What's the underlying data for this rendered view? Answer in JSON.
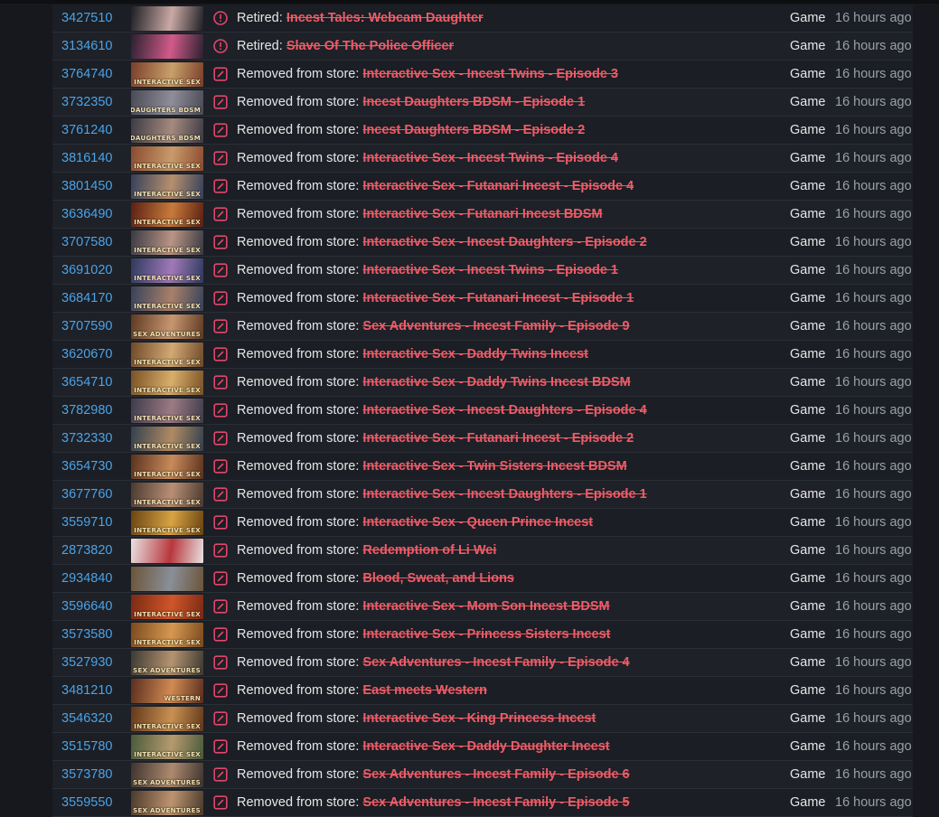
{
  "colors": {
    "link": "#4aa3e8",
    "removed": "#ef5b67",
    "icon": "#e0476a"
  },
  "rows": [
    {
      "appid": "3427510",
      "prefix": "Retired:",
      "name": "Incest Tales: Webcam Daughter",
      "type": "Game",
      "time": "16 hours ago",
      "icon": "alert-circle-icon",
      "thumb_text": "",
      "c1": "#1e1e24",
      "c2": "#c9a9a4"
    },
    {
      "appid": "3134610",
      "prefix": "Retired:",
      "name": "Slave Of The Police Officer",
      "type": "Game",
      "time": "16 hours ago",
      "icon": "alert-circle-icon",
      "thumb_text": "",
      "c1": "#2b2130",
      "c2": "#d15a8a"
    },
    {
      "appid": "3764740",
      "prefix": "Removed from store:",
      "name": "Interactive Sex - Incest Twins - Episode 3",
      "type": "Game",
      "time": "16 hours ago",
      "icon": "edit-square-icon",
      "thumb_text": "INTERACTIVE SEX",
      "c1": "#7a3e2a",
      "c2": "#c8a06a"
    },
    {
      "appid": "3732350",
      "prefix": "Removed from store:",
      "name": "Incest Daughters BDSM - Episode 1",
      "type": "Game",
      "time": "16 hours ago",
      "icon": "edit-square-icon",
      "thumb_text": "INCEST DAUGHTERS BDSM",
      "c1": "#4a4a55",
      "c2": "#8e8d99"
    },
    {
      "appid": "3761240",
      "prefix": "Removed from store:",
      "name": "Incest Daughters BDSM - Episode 2",
      "type": "Game",
      "time": "16 hours ago",
      "icon": "edit-square-icon",
      "thumb_text": "INCEST DAUGHTERS BDSM",
      "c1": "#3d3b44",
      "c2": "#a48a7e"
    },
    {
      "appid": "3816140",
      "prefix": "Removed from store:",
      "name": "Interactive Sex - Incest Twins - Episode 4",
      "type": "Game",
      "time": "16 hours ago",
      "icon": "edit-square-icon",
      "thumb_text": "INTERACTIVE SEX",
      "c1": "#8a4b2f",
      "c2": "#c99a6b"
    },
    {
      "appid": "3801450",
      "prefix": "Removed from store:",
      "name": "Interactive Sex - Futanari Incest - Episode 4",
      "type": "Game",
      "time": "16 hours ago",
      "icon": "edit-square-icon",
      "thumb_text": "INTERACTIVE SEX",
      "c1": "#35405a",
      "c2": "#b68f6e"
    },
    {
      "appid": "3636490",
      "prefix": "Removed from store:",
      "name": "Interactive Sex - Futanari Incest BDSM",
      "type": "Game",
      "time": "16 hours ago",
      "icon": "edit-square-icon",
      "thumb_text": "INTERACTIVE SEX",
      "c1": "#5a2012",
      "c2": "#c87a3a"
    },
    {
      "appid": "3707580",
      "prefix": "Removed from store:",
      "name": "Interactive Sex - Incest Daughters - Episode 2",
      "type": "Game",
      "time": "16 hours ago",
      "icon": "edit-square-icon",
      "thumb_text": "INTERACTIVE SEX",
      "c1": "#3a3a44",
      "c2": "#b99484"
    },
    {
      "appid": "3691020",
      "prefix": "Removed from store:",
      "name": "Interactive Sex - Incest Twins - Episode 1",
      "type": "Game",
      "time": "16 hours ago",
      "icon": "edit-square-icon",
      "thumb_text": "INTERACTIVE SEX",
      "c1": "#2e3a5e",
      "c2": "#a079b8"
    },
    {
      "appid": "3684170",
      "prefix": "Removed from store:",
      "name": "Interactive Sex - Futanari Incest - Episode 1",
      "type": "Game",
      "time": "16 hours ago",
      "icon": "edit-square-icon",
      "thumb_text": "INTERACTIVE SEX",
      "c1": "#37425a",
      "c2": "#a88069"
    },
    {
      "appid": "3707590",
      "prefix": "Removed from store:",
      "name": "Sex Adventures - Incest Family - Episode 9",
      "type": "Game",
      "time": "16 hours ago",
      "icon": "edit-square-icon",
      "thumb_text": "SEX ADVENTURES",
      "c1": "#5e3a22",
      "c2": "#c79670"
    },
    {
      "appid": "3620670",
      "prefix": "Removed from store:",
      "name": "Interactive Sex - Daddy Twins Incest",
      "type": "Game",
      "time": "16 hours ago",
      "icon": "edit-square-icon",
      "thumb_text": "INTERACTIVE SEX",
      "c1": "#6e4a2a",
      "c2": "#d2a873"
    },
    {
      "appid": "3654710",
      "prefix": "Removed from store:",
      "name": "Interactive Sex - Daddy Twins Incest BDSM",
      "type": "Game",
      "time": "16 hours ago",
      "icon": "edit-square-icon",
      "thumb_text": "INTERACTIVE SEX",
      "c1": "#7a5226",
      "c2": "#d9ae6a"
    },
    {
      "appid": "3782980",
      "prefix": "Removed from store:",
      "name": "Interactive Sex - Incest Daughters - Episode 4",
      "type": "Game",
      "time": "16 hours ago",
      "icon": "edit-square-icon",
      "thumb_text": "INTERACTIVE SEX",
      "c1": "#3e3c4a",
      "c2": "#9c7a84"
    },
    {
      "appid": "3732330",
      "prefix": "Removed from store:",
      "name": "Interactive Sex - Futanari Incest - Episode 2",
      "type": "Game",
      "time": "16 hours ago",
      "icon": "edit-square-icon",
      "thumb_text": "INTERACTIVE SEX",
      "c1": "#34404e",
      "c2": "#b08a64"
    },
    {
      "appid": "3654730",
      "prefix": "Removed from store:",
      "name": "Interactive Sex - Twin Sisters Incest BDSM",
      "type": "Game",
      "time": "16 hours ago",
      "icon": "edit-square-icon",
      "thumb_text": "INTERACTIVE SEX",
      "c1": "#5a321e",
      "c2": "#c88a5a"
    },
    {
      "appid": "3677760",
      "prefix": "Removed from store:",
      "name": "Interactive Sex - Incest Daughters - Episode 1",
      "type": "Game",
      "time": "16 hours ago",
      "icon": "edit-square-icon",
      "thumb_text": "INTERACTIVE SEX",
      "c1": "#4a3a30",
      "c2": "#b98f74"
    },
    {
      "appid": "3559710",
      "prefix": "Removed from store:",
      "name": "Interactive Sex - Queen Prince Incest",
      "type": "Game",
      "time": "16 hours ago",
      "icon": "edit-square-icon",
      "thumb_text": "INTERACTIVE SEX",
      "c1": "#6a4412",
      "c2": "#d8a342"
    },
    {
      "appid": "2873820",
      "prefix": "Removed from store:",
      "name": "Redemption of Li Wei",
      "type": "Game",
      "time": "16 hours ago",
      "icon": "edit-square-icon",
      "thumb_text": "",
      "c1": "#e9e2e2",
      "c2": "#b8373e"
    },
    {
      "appid": "2934840",
      "prefix": "Removed from store:",
      "name": "Blood, Sweat, and Lions",
      "type": "Game",
      "time": "16 hours ago",
      "icon": "edit-square-icon",
      "thumb_text": "",
      "c1": "#6a5438",
      "c2": "#8a8f98"
    },
    {
      "appid": "3596640",
      "prefix": "Removed from store:",
      "name": "Interactive Sex - Mom Son Incest BDSM",
      "type": "Game",
      "time": "16 hours ago",
      "icon": "edit-square-icon",
      "thumb_text": "INTERACTIVE SEX",
      "c1": "#7a2a12",
      "c2": "#d0552a"
    },
    {
      "appid": "3573580",
      "prefix": "Removed from store:",
      "name": "Interactive Sex - Princess Sisters Incest",
      "type": "Game",
      "time": "16 hours ago",
      "icon": "edit-square-icon",
      "thumb_text": "INTERACTIVE SEX",
      "c1": "#7a4a1e",
      "c2": "#d69850"
    },
    {
      "appid": "3527930",
      "prefix": "Removed from store:",
      "name": "Sex Adventures - Incest Family - Episode 4",
      "type": "Game",
      "time": "16 hours ago",
      "icon": "edit-square-icon",
      "thumb_text": "SEX ADVENTURES",
      "c1": "#3c3a32",
      "c2": "#b59370"
    },
    {
      "appid": "3481210",
      "prefix": "Removed from store:",
      "name": "East meets Western",
      "type": "Game",
      "time": "16 hours ago",
      "icon": "edit-square-icon",
      "thumb_text": "WESTERN",
      "c1": "#5a2e1e",
      "c2": "#d18a52"
    },
    {
      "appid": "3546320",
      "prefix": "Removed from store:",
      "name": "Interactive Sex - King Princess Incest",
      "type": "Game",
      "time": "16 hours ago",
      "icon": "edit-square-icon",
      "thumb_text": "INTERACTIVE SEX",
      "c1": "#62381a",
      "c2": "#c99052"
    },
    {
      "appid": "3515780",
      "prefix": "Removed from store:",
      "name": "Interactive Sex - Daddy Daughter Incest",
      "type": "Game",
      "time": "16 hours ago",
      "icon": "edit-square-icon",
      "thumb_text": "INTERACTIVE SEX",
      "c1": "#4a5a3a",
      "c2": "#b59a6e"
    },
    {
      "appid": "3573780",
      "prefix": "Removed from store:",
      "name": "Sex Adventures - Incest Family - Episode 6",
      "type": "Game",
      "time": "16 hours ago",
      "icon": "edit-square-icon",
      "thumb_text": "SEX ADVENTURES",
      "c1": "#3e3430",
      "c2": "#ad8a6e"
    },
    {
      "appid": "3559550",
      "prefix": "Removed from store:",
      "name": "Sex Adventures - Incest Family - Episode 5",
      "type": "Game",
      "time": "16 hours ago",
      "icon": "edit-square-icon",
      "thumb_text": "SEX ADVENTURES",
      "c1": "#4a3a2c",
      "c2": "#bd9470"
    }
  ]
}
